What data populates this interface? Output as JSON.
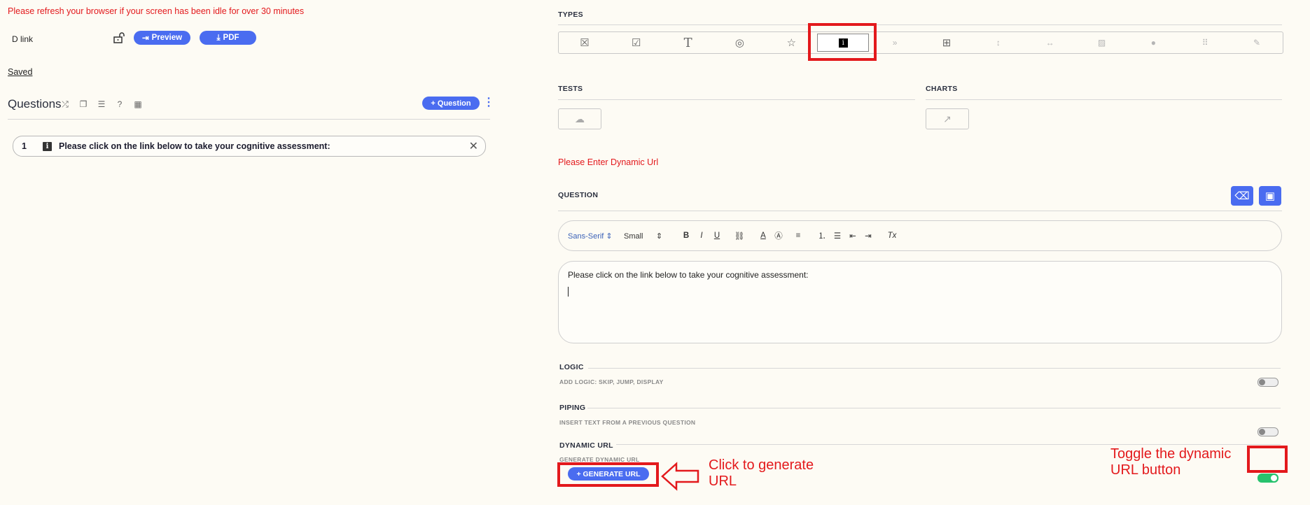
{
  "left": {
    "warning": "Please refresh your browser if your screen has been idle for over 30 minutes",
    "survey_name": "D link",
    "preview_label": "Preview",
    "pdf_label": "PDF",
    "saved": "Saved",
    "questions_title": "Questions",
    "add_question_label": "+ Question",
    "question_item": {
      "number": "1",
      "text": "Please click on the link below to take your cognitive assessment:"
    }
  },
  "right": {
    "types_label": "TYPES",
    "tests_label": "TESTS",
    "charts_label": "CHARTS",
    "dynamic_warning": "Please Enter Dynamic Url",
    "question_label": "QUESTION",
    "toolbar": {
      "font": "Sans-Serif",
      "size": "Small"
    },
    "editor_text": "Please click on the link below to take your cognitive assessment:",
    "logic_label": "LOGIC",
    "logic_sub": "ADD LOGIC: SKIP, JUMP, DISPLAY",
    "piping_label": "PIPING",
    "piping_sub": "INSERT TEXT FROM A PREVIOUS QUESTION",
    "dynamic_url_label": "DYNAMIC URL",
    "dynamic_url_sub": "GENERATE DYNAMIC URL",
    "generate_url_label": "+ GENERATE URL",
    "logic_enabled": false,
    "piping_enabled": false,
    "dynamic_url_enabled": true
  },
  "annotations": {
    "generate": "Click to generate URL",
    "toggle": "Toggle the dynamic URL button"
  },
  "colors": {
    "accent": "#4a6cf0",
    "warning": "#e3191c",
    "toggle_on": "#27c26d",
    "background": "#fdfbf4"
  },
  "icons": [
    "lock-open-icon",
    "shuffle-icon",
    "copy-icon",
    "list-icon",
    "help-icon",
    "calendar-icon",
    "checkbox-x-icon",
    "checkbox-icon",
    "text-icon",
    "camera-icon",
    "star-icon",
    "info-icon",
    "chevron-double-down-icon",
    "layout-icon",
    "vertical-arrows-icon",
    "horizontal-arrows-icon",
    "image-icon",
    "clock-icon",
    "grid-icon",
    "edit-icon",
    "eraser-icon",
    "image-upload-icon"
  ]
}
